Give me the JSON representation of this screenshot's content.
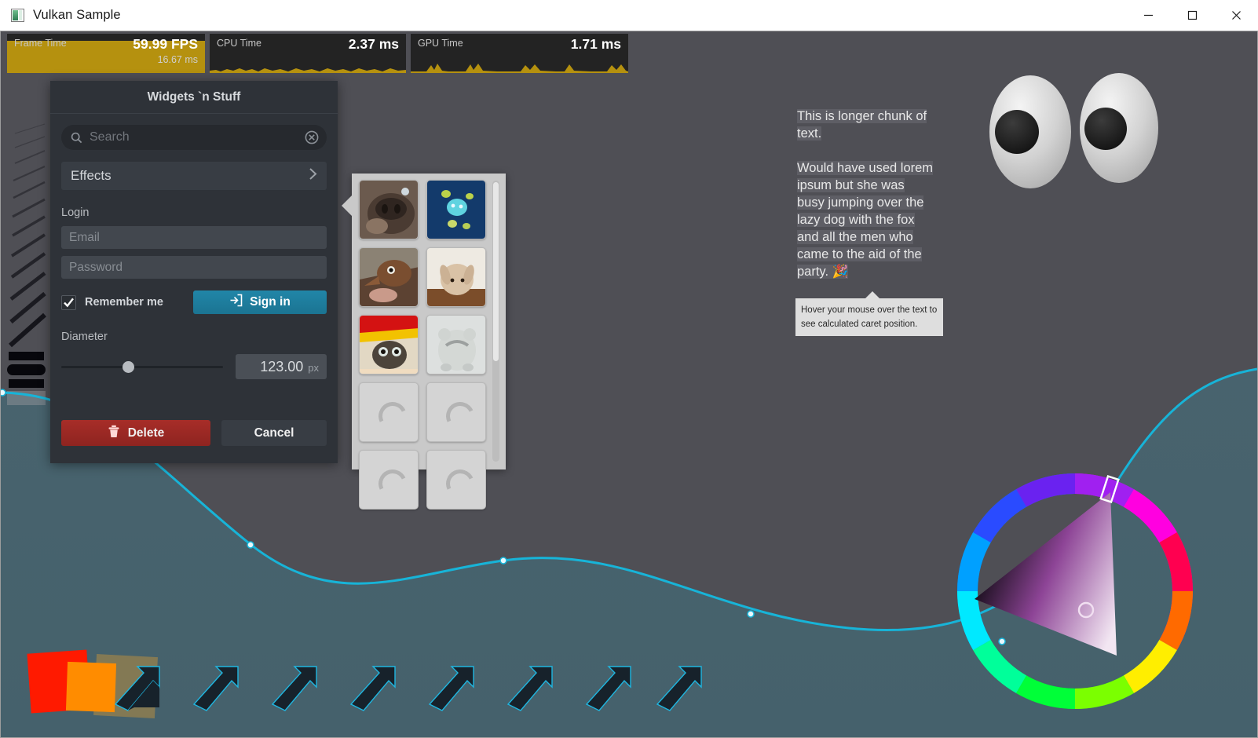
{
  "window": {
    "title": "Vulkan Sample",
    "icon": "app-window-icon",
    "controls": {
      "minimize": "minimize-icon",
      "maximize": "maximize-icon",
      "close": "close-icon"
    }
  },
  "perf": {
    "accent_color": "#b5910f",
    "panel_bg": "#232323",
    "graphs": [
      {
        "label": "Frame Time",
        "main": "59.99 FPS",
        "sub": "16.67 ms",
        "fill_ratio": 0.82
      },
      {
        "label": "CPU Time",
        "main": "2.37 ms",
        "sub": "",
        "fill_ratio": 0.1
      },
      {
        "label": "GPU Time",
        "main": "1.71 ms",
        "sub": "",
        "fill_ratio": 0.08
      }
    ]
  },
  "dialog": {
    "title": "Widgets `n Stuff",
    "search": {
      "placeholder": "Search",
      "value": "",
      "icon": "search-icon",
      "clear_icon": "clear-circle-icon"
    },
    "effects": {
      "label": "Effects",
      "chevron": "chevron-right-icon"
    },
    "login": {
      "section_label": "Login",
      "email_placeholder": "Email",
      "email_value": "",
      "password_placeholder": "Password",
      "password_value": "",
      "remember_label": "Remember me",
      "remember_checked": true,
      "signin_label": "Sign in",
      "signin_icon": "login-arrow-icon",
      "signin_color": "#1f7e9e"
    },
    "diameter": {
      "label": "Diameter",
      "value": "123.00",
      "unit": "px",
      "slider_percent": 40
    },
    "actions": {
      "delete_label": "Delete",
      "delete_icon": "trash-icon",
      "delete_color": "#9c2a25",
      "cancel_label": "Cancel"
    }
  },
  "image_popup": {
    "tiles": [
      {
        "kind": "photo",
        "name": "dog-nose-photo"
      },
      {
        "kind": "photo",
        "name": "jellyfish-photo"
      },
      {
        "kind": "photo",
        "name": "shrew-photo"
      },
      {
        "kind": "photo",
        "name": "rabbit-photo"
      },
      {
        "kind": "photo",
        "name": "cat-in-hat-photo"
      },
      {
        "kind": "photo",
        "name": "bear-cub-photo"
      },
      {
        "kind": "loading",
        "name": "loading-tile"
      },
      {
        "kind": "loading",
        "name": "loading-tile"
      },
      {
        "kind": "loading",
        "name": "loading-tile"
      },
      {
        "kind": "loading",
        "name": "loading-tile"
      }
    ],
    "scroll_thumb_percent": 64
  },
  "text_panel": {
    "lines": [
      "This is longer chunk of",
      "text.",
      "",
      "Would have used lorem",
      "ipsum but she   was",
      "busy jumping over the",
      "lazy dog with the fox",
      "and all the men who",
      "came to the aid of the",
      "party. 🎉"
    ]
  },
  "tooltip": {
    "line1": "Hover your mouse over the text to",
    "line2": "see calculated caret position."
  },
  "canvas": {
    "bg_top_color": "#4f4f55",
    "bg_bottom_color": "#4a6670",
    "curve_color": "#17b4d8",
    "eyes": {
      "name": "googly-eyes-widget",
      "count": 2
    },
    "color_wheel": {
      "name": "color-wheel-picker",
      "marker": "hue-marker",
      "selector": "saturation-value-selector"
    },
    "shapes": {
      "red_square": "#ff1a00",
      "orange_square": "#ff8c00",
      "olive_square": "#8a7c52",
      "arrow_count": 8
    }
  }
}
